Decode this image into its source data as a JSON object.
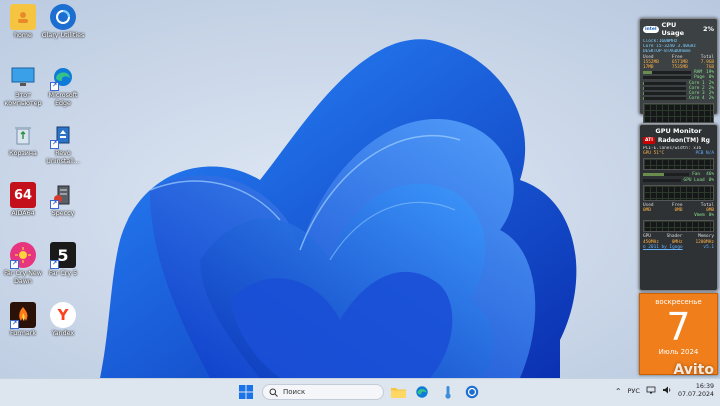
{
  "desktop_icons": [
    {
      "label": "home",
      "icon": "user-folder-icon"
    },
    {
      "label": "Glary Utilities",
      "icon": "glary-utilities-icon"
    },
    {
      "label": "Этот компьютер",
      "icon": "this-pc-icon"
    },
    {
      "label": "Microsoft Edge",
      "icon": "edge-icon"
    },
    {
      "label": "Корзина",
      "icon": "recycle-bin-icon"
    },
    {
      "label": "Revo Uninstall...",
      "icon": "revo-uninstaller-icon"
    },
    {
      "label": "AIDA64",
      "icon": "aida64-icon"
    },
    {
      "label": "Speccy",
      "icon": "speccy-icon"
    },
    {
      "label": "Far Cry New Dawn",
      "icon": "far-cry-new-dawn-icon"
    },
    {
      "label": "Far Cry 5",
      "icon": "far-cry-5-icon"
    },
    {
      "label": "Furmark",
      "icon": "furmark-icon"
    },
    {
      "label": "Yandex",
      "icon": "yandex-icon"
    }
  ],
  "cpu_gadget": {
    "title": "CPU Usage",
    "total": "2%",
    "clock": "Clock:1600MHz",
    "model": "Core i5-3240 3.40GHz",
    "host": "DESKTOP-8TAGDDHome",
    "mem_headers": [
      "Used",
      "Free",
      "Total"
    ],
    "ram_row": [
      "1552MB",
      "6571MB",
      "7.9GB"
    ],
    "page_row": [
      "17MB",
      "7535MB",
      "7GB"
    ],
    "ram_label": "RAM",
    "ram_pct": "19%",
    "ram_fill": 0.19,
    "rows": [
      {
        "label": "Page",
        "value": "0%"
      },
      {
        "label": "Core 1",
        "value": "2%"
      },
      {
        "label": "Core 2",
        "value": "2%"
      },
      {
        "label": "Core 3",
        "value": "2%"
      },
      {
        "label": "Core 4",
        "value": "2%"
      }
    ]
  },
  "gpu_gadget": {
    "title": "GPU Monitor",
    "vendor": "ATI",
    "model": "Radeon(TM) Rg",
    "bus": "PCI-E.lanes/width: x16",
    "temp_label": "GPU 51°C",
    "pcb_label": "PCB N/A",
    "fan_label": "Fan",
    "fan_value": "46%",
    "fan_fill": 0.46,
    "load_label": "GPU Load",
    "load_value": "0%",
    "mem_headers": [
      "Used",
      "Free",
      "Total"
    ],
    "mem_values": [
      "0MB",
      "0MB",
      "0MB"
    ],
    "vram_label": "Vmem",
    "vram_value": "0%",
    "clock_headers": [
      "GPU",
      "Shader",
      "Memory"
    ],
    "clock_values": [
      "450MHz",
      "0MHz",
      "1200MHz"
    ],
    "copyright": "© 2011 by Igogo",
    "version": "v5.1"
  },
  "calendar": {
    "weekday": "воскресенье",
    "day": "7",
    "month_year": "Июль 2024"
  },
  "taskbar": {
    "search_placeholder": "Поиск",
    "language": "РУС",
    "time": "16:39",
    "date": "07.07.2024"
  },
  "watermark": "Avito",
  "colors": {
    "wallpaper_blue": "#1f5fd8",
    "calendar_orange": "#f07e1b",
    "taskbar_bg": "#dde5ef"
  }
}
